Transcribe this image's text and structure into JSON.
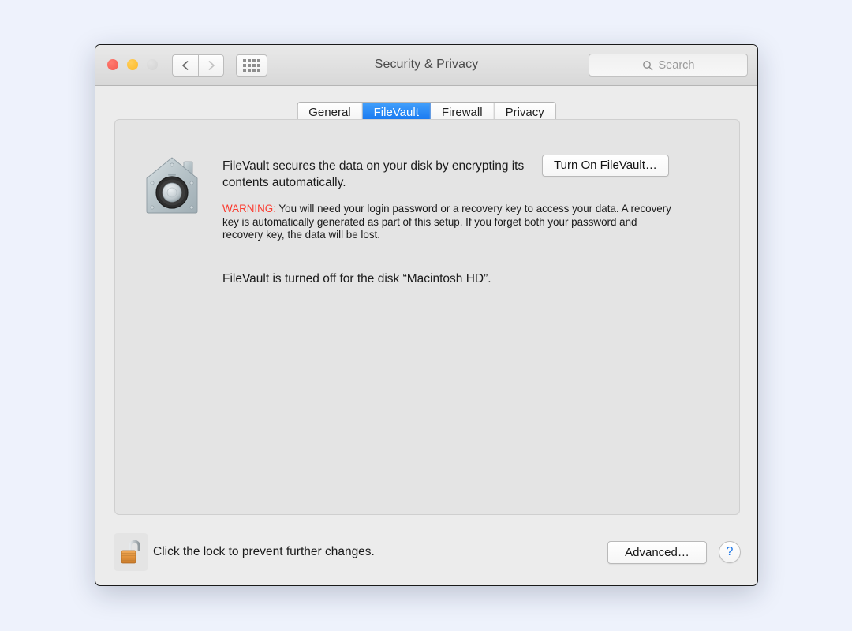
{
  "window": {
    "title": "Security & Privacy",
    "traffic_lights": [
      {
        "name": "close",
        "color": "#f4594f"
      },
      {
        "name": "minimize",
        "color": "#fdb827"
      },
      {
        "name": "zoom",
        "color": "#d2d2d2"
      }
    ],
    "nav": {
      "back_icon": "chevron-left-icon",
      "forward_icon": "chevron-right-icon",
      "grid_icon": "show-all-grid-icon"
    }
  },
  "search": {
    "placeholder": "Search",
    "icon": "search-icon"
  },
  "tabs": [
    {
      "label": "General",
      "selected": false
    },
    {
      "label": "FileVault",
      "selected": true
    },
    {
      "label": "Firewall",
      "selected": false
    },
    {
      "label": "Privacy",
      "selected": false
    }
  ],
  "panel": {
    "icon": "filevault-safe-icon",
    "description": "FileVault secures the data on your disk by encrypting its contents automatically.",
    "warning_label": "WARNING:",
    "warning_text": " You will need your login password or a recovery key to access your data. A recovery key is automatically generated as part of this setup. If you forget both your password and recovery key, the data will be lost.",
    "status": "FileVault is turned off for the disk “Macintosh HD”.",
    "turn_on_button": "Turn On FileVault…"
  },
  "footer": {
    "lock_icon": "unlocked-padlock-icon",
    "lock_text": "Click the lock to prevent further changes.",
    "advanced_button": "Advanced…",
    "help_button": "?"
  },
  "colors": {
    "accent_blue": "#1072ef",
    "warning_red": "#fb3b2f",
    "desktop_background": "#eef2fc",
    "window_background": "#ececec",
    "panel_background": "#e4e4e4"
  }
}
